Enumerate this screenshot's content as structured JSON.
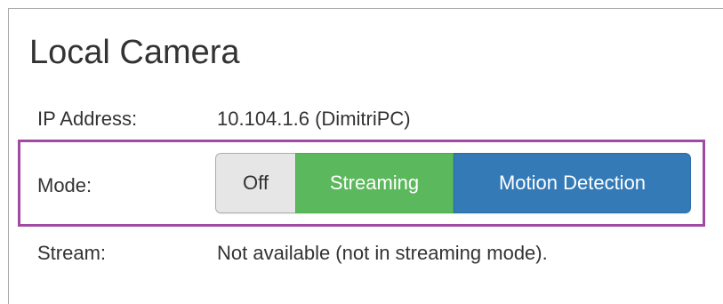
{
  "panel": {
    "title": "Local Camera"
  },
  "info": {
    "ip_label": "IP Address:",
    "ip_value": "10.104.1.6 (DimitriPC)",
    "mode_label": "Mode:",
    "stream_label": "Stream:",
    "stream_value": "Not available (not in streaming mode)."
  },
  "mode_buttons": {
    "off": "Off",
    "streaming": "Streaming",
    "motion_detection": "Motion Detection",
    "selected": "Motion Detection"
  },
  "colors": {
    "highlight_border": "#a14aa3",
    "off_bg": "#e6e6e6",
    "streaming_bg": "#5cb85c",
    "motion_bg": "#337ab7",
    "text": "#333333"
  }
}
